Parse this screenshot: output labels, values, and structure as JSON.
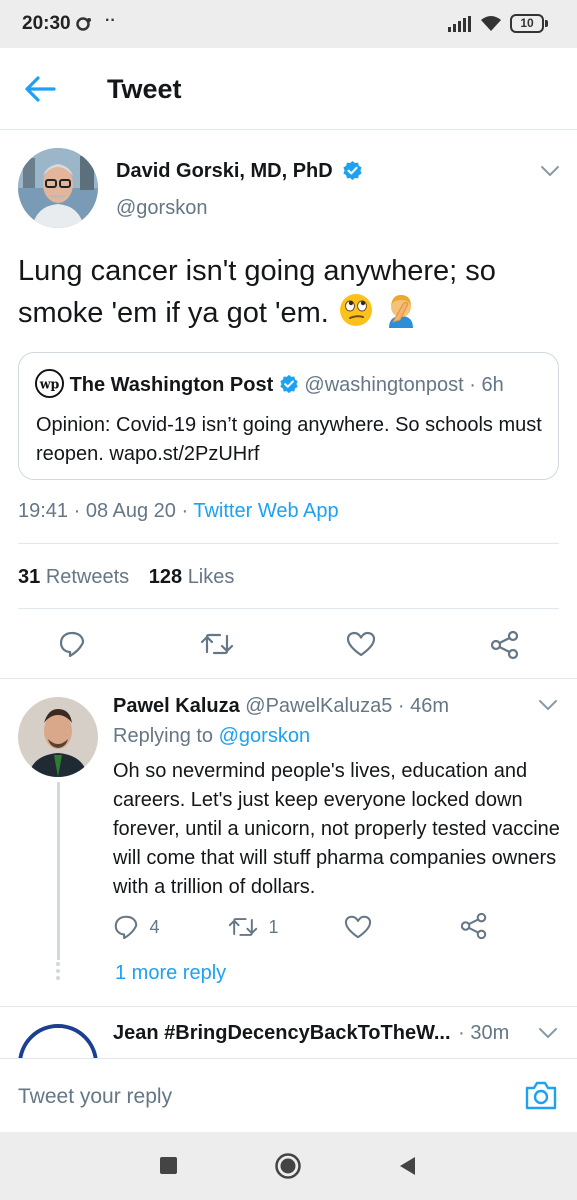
{
  "status_bar": {
    "time": "20:30",
    "battery": "10"
  },
  "header": {
    "title": "Tweet"
  },
  "tweet": {
    "author_name": "David Gorski, MD, PhD",
    "handle": "@gorskon",
    "text_line1": "Lung cancer isn't going anywhere; so",
    "text_line2": "smoke 'em if ya got 'em.",
    "emojis": [
      "face-with-rolling-eyes-emoji",
      "person-facepalming-emoji"
    ],
    "quote": {
      "author_name": "The Washington Post",
      "handle": "@washingtonpost",
      "time": "· 6h",
      "text": "Opinion: Covid-19 isn’t going anywhere. So schools must reopen. wapo.st/2PzUHrf"
    },
    "time": "19:41",
    "date": "· 08 Aug 20 ·",
    "source": "Twitter Web App",
    "retweets_count": "31",
    "retweets_label": "Retweets",
    "likes_count": "128",
    "likes_label": "Likes"
  },
  "reply": {
    "author_name": "Pawel Kaluza",
    "handle": "@PawelKaluza5",
    "time": "· 46m",
    "replying_prefix": "Replying to",
    "replying_handle": "@gorskon",
    "text": "Oh so nevermind people's lives, education and careers. Let's just keep everyone locked down forever, until a unicorn, not properly tested vaccine will come that will stuff pharma companies owners with a trillion of dollars.",
    "reply_count": "4",
    "retweet_count": "1",
    "more_replies": "1 more reply"
  },
  "next_reply": {
    "author_name": "Jean #BringDecencyBackToTheW...",
    "time": "30m"
  },
  "compose": {
    "placeholder": "Tweet your reply"
  },
  "colors": {
    "accent": "#1da1f2",
    "muted": "#657786",
    "text": "#14171a",
    "border": "#e1e8ed"
  }
}
